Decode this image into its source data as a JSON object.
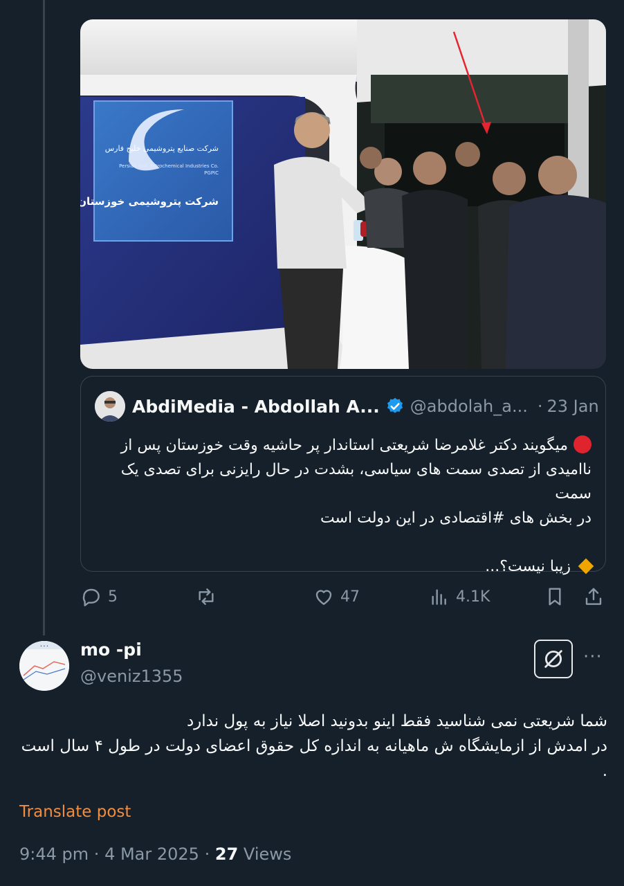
{
  "quoted_post": {
    "author_name": "AbdiMedia - Abdollah A...",
    "author_handle": "@abdolah_a...",
    "separator": "·",
    "date": "23 Jan",
    "text_line_1": "میگویند دکتر غلامرضا شریعتی استاندار پر حاشیه وقت خوزستان پس از",
    "text_line_2": "ناامیدی از تصدی سمت های سیاسی، بشدت در حال رایزنی برای تصدی یک سمت",
    "text_line_3": "در بخش های #اقتصادی در این دولت است",
    "text_last": "زیبا نیست؟...",
    "icons": {
      "lead": "red-circle-emoji",
      "last": "orange-diamond-emoji"
    }
  },
  "photo": {
    "sign_text_top": "شرکت صنایع پتروشیمی خلیج فارس",
    "sign_text_en": "Persian Gulf Petrochemical Industries Co.",
    "sign_text_code": "PGPIC",
    "sign_text_bottom": "شرکت پتروشیمی خوزستان"
  },
  "actions": {
    "replies": "5",
    "reposts": "",
    "likes": "47",
    "views": "4.1K",
    "icons": [
      "reply-icon",
      "repost-icon",
      "like-icon",
      "views-icon",
      "bookmark-icon",
      "share-icon"
    ]
  },
  "reply": {
    "author_name": "mo -pi",
    "author_handle": "@veniz1355",
    "text_line_1": "شما شریعتی نمی شناسید فقط اینو بدونید اصلا نیاز به پول ندارد",
    "text_line_2": "در امدش از ازمایشگاه ش ماهیانه به اندازه کل حقوق اعضای دولت در طول ۴ سال است",
    "text_line_3": ".",
    "translate_label": "Translate post",
    "more_label": "···",
    "time": "9:44 pm",
    "date": "4 Mar 2025",
    "sep": "·",
    "views_count": "27",
    "views_label": "Views"
  },
  "colors": {
    "background": "#15202b",
    "secondary_text": "#8b98a5",
    "translate_link": "#f18d3f",
    "verified_badge": "#1d9bf0"
  }
}
